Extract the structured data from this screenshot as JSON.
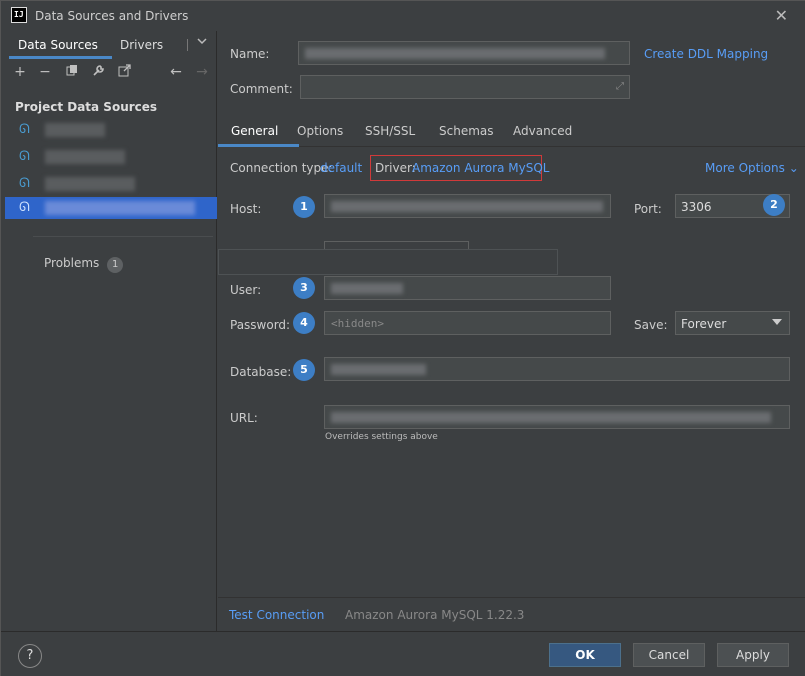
{
  "window": {
    "title": "Data Sources and Drivers",
    "icon_label": "IJ"
  },
  "sidebar": {
    "tabs": [
      "Data Sources",
      "Drivers"
    ],
    "section_title": "Project Data Sources",
    "problems_label": "Problems",
    "problems_count": "1",
    "toolbar_icons": [
      "add-icon",
      "remove-icon",
      "duplicate-icon",
      "wrench-icon",
      "export-icon",
      "back-icon",
      "forward-icon"
    ]
  },
  "form": {
    "name_label": "Name:",
    "comment_label": "Comment:",
    "create_ddl": "Create DDL Mapping",
    "tabs": [
      "General",
      "Options",
      "SSH/SSL",
      "Schemas",
      "Advanced"
    ],
    "connection_type_label": "Connection type:",
    "connection_type_value": "default",
    "driver_label": "Driver:",
    "driver_value": "Amazon Aurora MySQL",
    "more_options": "More Options",
    "host_label": "Host:",
    "port_label": "Port:",
    "port_value": "3306",
    "user_label": "User:",
    "password_label": "Password:",
    "password_placeholder": "<hidden>",
    "save_label": "Save:",
    "save_value": "Forever",
    "database_label": "Database:",
    "url_label": "URL:",
    "url_hint": "Overrides settings above",
    "markers": [
      "1",
      "2",
      "3",
      "4",
      "5"
    ]
  },
  "bottom": {
    "test_connection": "Test Connection",
    "driver_version": "Amazon Aurora MySQL 1.22.3"
  },
  "footer": {
    "help": "?",
    "ok": "OK",
    "cancel": "Cancel",
    "apply": "Apply"
  },
  "colors": {
    "accent": "#4a88c7",
    "link": "#589df6",
    "marker": "#3d7ec5",
    "highlight_box": "#d03a3a",
    "selection": "#2f65ca"
  }
}
